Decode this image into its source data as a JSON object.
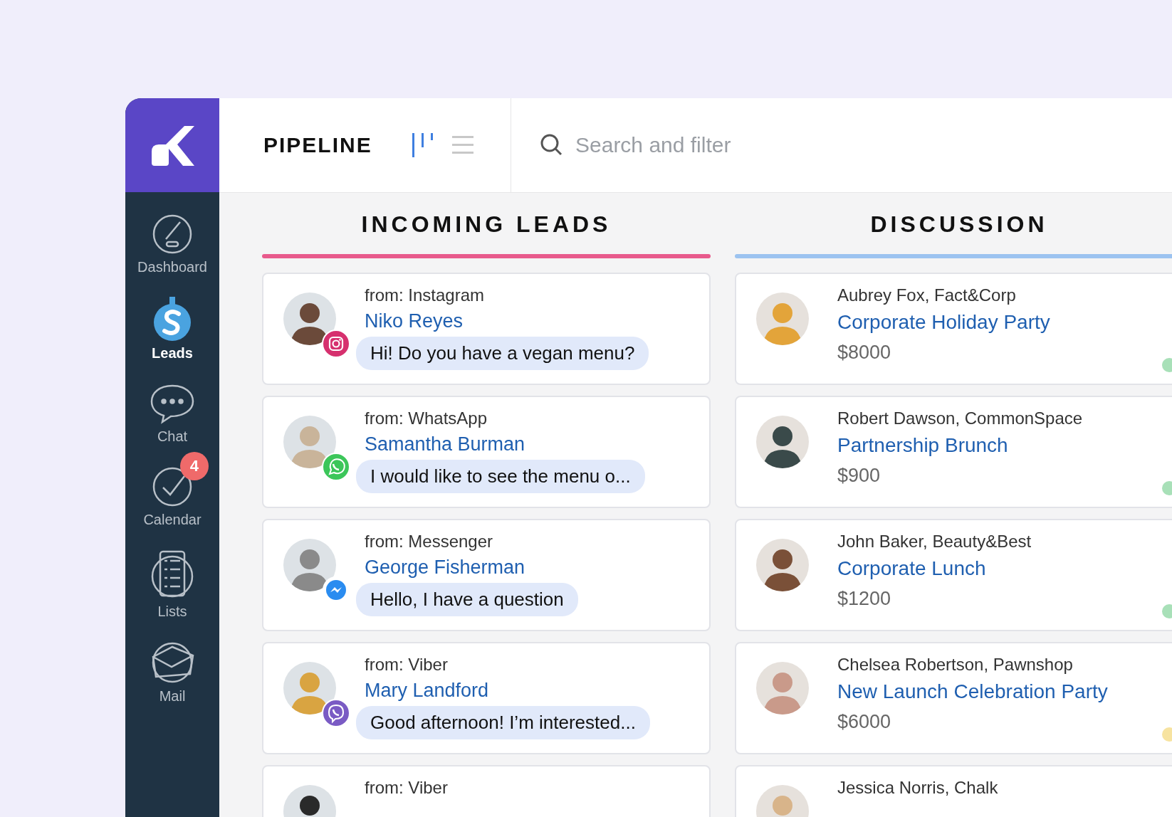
{
  "header": {
    "title": "PIPELINE",
    "views": [
      {
        "kind": "board",
        "selected": true
      },
      {
        "kind": "list",
        "selected": false
      }
    ],
    "search": {
      "placeholder": "Search and filter"
    }
  },
  "sidebar": {
    "items": [
      {
        "kind": "dashboard",
        "label": "Dashboard",
        "selected": false
      },
      {
        "kind": "leads",
        "label": "Leads",
        "selected": true
      },
      {
        "kind": "chat",
        "label": "Chat",
        "selected": false
      },
      {
        "kind": "calendar",
        "label": "Calendar",
        "selected": false,
        "badge": "4"
      },
      {
        "kind": "lists",
        "label": "Lists",
        "selected": false
      },
      {
        "kind": "mail",
        "label": "Mail",
        "selected": false
      }
    ]
  },
  "columns": [
    {
      "title": "INCOMING LEADS",
      "color": "#e85a8c",
      "cards": [
        {
          "kind": "lead",
          "platform": {
            "kind": "instagram"
          },
          "source": "from: Instagram",
          "name": "Niko Reyes",
          "message": "Hi! Do you have a vegan menu?"
        },
        {
          "kind": "lead",
          "platform": {
            "kind": "whatsapp"
          },
          "source": "from: WhatsApp",
          "name": "Samantha Burman",
          "message": "I would like to see the menu o..."
        },
        {
          "kind": "lead",
          "platform": {
            "kind": "messenger"
          },
          "source": "from: Messenger",
          "name": "George Fisherman",
          "message": "Hello, I have a question"
        },
        {
          "kind": "lead",
          "platform": {
            "kind": "viber"
          },
          "source": "from: Viber",
          "name": "Mary Landford",
          "message": "Good afternoon! I’m interested..."
        },
        {
          "kind": "lead",
          "source": "from: Viber"
        }
      ]
    },
    {
      "title": "DISCUSSION",
      "color": "#9cc3f0",
      "cards": [
        {
          "kind": "deal",
          "contact": "Aubrey Fox, Fact&Corp",
          "title": "Corporate Holiday Party",
          "amount": "$8000",
          "color": "#a8e0b8"
        },
        {
          "kind": "deal",
          "contact": "Robert Dawson, CommonSpace",
          "title": "Partnership Brunch",
          "amount": "$900",
          "color": "#a8e0b8"
        },
        {
          "kind": "deal",
          "contact": "John Baker, Beauty&Best",
          "title": "Corporate Lunch",
          "amount": "$1200",
          "color": "#a8e0b8"
        },
        {
          "kind": "deal",
          "contact": "Chelsea Robertson, Pawnshop",
          "title": "New Launch Celebration Party",
          "amount": "$6000",
          "color": "#f7e3a0"
        },
        {
          "kind": "deal",
          "contact": "Jessica Norris, Chalk"
        }
      ]
    }
  ]
}
